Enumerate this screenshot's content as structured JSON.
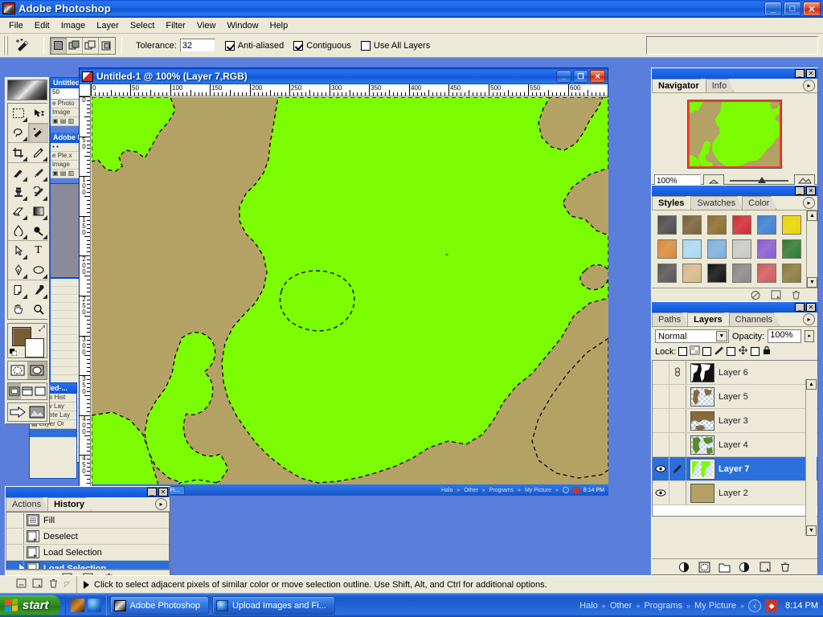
{
  "app": {
    "title": "Adobe Photoshop",
    "icon": "photoshop-icon",
    "window_buttons": {
      "minimize": "_",
      "maximize": "□",
      "close": "✕"
    }
  },
  "menu": [
    {
      "label": "File"
    },
    {
      "label": "Edit"
    },
    {
      "label": "Image"
    },
    {
      "label": "Layer"
    },
    {
      "label": "Select"
    },
    {
      "label": "Filter"
    },
    {
      "label": "View"
    },
    {
      "label": "Window"
    },
    {
      "label": "Help"
    }
  ],
  "options_bar": {
    "active_tool": "magic-wand-tool",
    "selection_modes": [
      "new-selection",
      "add-to-selection",
      "subtract-from-selection",
      "intersect-with-selection"
    ],
    "selection_mode_active": 0,
    "tolerance_label": "Tolerance:",
    "tolerance_value": "32",
    "anti_aliased_label": "Anti-aliased",
    "anti_aliased_checked": true,
    "contiguous_label": "Contiguous",
    "contiguous_checked": true,
    "use_all_layers_label": "Use All Layers",
    "use_all_layers_checked": false
  },
  "tools": [
    {
      "name": "marquee-tool",
      "glyph": "▭"
    },
    {
      "name": "move-tool",
      "glyph": "✥"
    },
    {
      "name": "lasso-tool",
      "glyph": "◠"
    },
    {
      "name": "magic-wand-tool",
      "glyph": "✸"
    },
    {
      "name": "crop-tool",
      "glyph": "⌗"
    },
    {
      "name": "slice-tool",
      "glyph": "✎"
    },
    {
      "name": "healing-brush-tool",
      "glyph": "✒"
    },
    {
      "name": "brush-tool",
      "glyph": "🖌"
    },
    {
      "name": "clone-stamp-tool",
      "glyph": "⎙"
    },
    {
      "name": "history-brush-tool",
      "glyph": "⟲"
    },
    {
      "name": "eraser-tool",
      "glyph": "▱"
    },
    {
      "name": "gradient-tool",
      "glyph": "▦"
    },
    {
      "name": "blur-tool",
      "glyph": "💧"
    },
    {
      "name": "dodge-tool",
      "glyph": "●"
    },
    {
      "name": "path-selection-tool",
      "glyph": "↖"
    },
    {
      "name": "type-tool",
      "glyph": "T"
    },
    {
      "name": "pen-tool",
      "glyph": "✑"
    },
    {
      "name": "shape-tool",
      "glyph": "⬭"
    },
    {
      "name": "notes-tool",
      "glyph": "▤"
    },
    {
      "name": "eyedropper-tool",
      "glyph": "⚲"
    },
    {
      "name": "hand-tool",
      "glyph": "✋"
    },
    {
      "name": "zoom-tool",
      "glyph": "🔍"
    }
  ],
  "color_swatches": {
    "foreground": "#7a5c34",
    "background": "#ffffff"
  },
  "document": {
    "title": "Untitled-1 @ 100% (Layer 7,RGB)",
    "zoom": "100%",
    "mode": "RGB",
    "active_layer": "Layer 7",
    "ruler_h_labels": [
      "0",
      "50",
      "100",
      "150",
      "200",
      "250",
      "300",
      "350",
      "400",
      "450",
      "500",
      "550",
      "600"
    ],
    "ruler_v_labels": [
      "0",
      "50",
      "100",
      "150",
      "200",
      "250",
      "300",
      "350",
      "400",
      "450"
    ],
    "canvas_colors": {
      "land": "#7cfc00",
      "water": "#b3a263"
    }
  },
  "navigator": {
    "tabs": [
      {
        "label": "Navigator",
        "active": true
      },
      {
        "label": "Info",
        "active": false
      }
    ],
    "zoom_value": "100%",
    "menu_icon": "panel-menu-icon"
  },
  "styles": {
    "tabs": [
      {
        "label": "Styles",
        "active": true
      },
      {
        "label": "Swatches",
        "active": false
      },
      {
        "label": "Color",
        "active": false
      }
    ],
    "swatches": [
      "#4a4a4a",
      "#7a6134",
      "#8a6c2e",
      "#d02a32",
      "#3a7fd0",
      "#e8d400",
      "#d98a3a",
      "#a8d8f0",
      "#7ab0e0",
      "#c8c8c8",
      "#8a5ad0",
      "#2e7a2e",
      "#555555",
      "#d8b888",
      "#111111",
      "#888888",
      "#d05a5a",
      "#8a7a3a"
    ],
    "footer_icons": [
      "clear-style-icon",
      "new-style-icon",
      "delete-style-icon"
    ]
  },
  "layers_panel": {
    "tabs": [
      {
        "label": "Paths",
        "active": false
      },
      {
        "label": "Layers",
        "active": true
      },
      {
        "label": "Channels",
        "active": false
      }
    ],
    "blend_mode": "Normal",
    "opacity_label": "Opacity:",
    "opacity_value": "100%",
    "lock_label": "Lock:",
    "lock_items": [
      "lock-transparent-icon",
      "lock-image-icon",
      "lock-position-icon",
      "lock-all-icon"
    ],
    "layers": [
      {
        "name": "Layer 6",
        "visible": false,
        "linked": true,
        "selected": false,
        "thumb": "black-white-map"
      },
      {
        "name": "Layer 5",
        "visible": false,
        "linked": false,
        "selected": false,
        "thumb": "brown-transparent-map"
      },
      {
        "name": "Layer 3",
        "visible": false,
        "linked": false,
        "selected": false,
        "thumb": "brown-map"
      },
      {
        "name": "Layer 4",
        "visible": false,
        "linked": false,
        "selected": false,
        "thumb": "green-map"
      },
      {
        "name": "Layer 7",
        "visible": true,
        "linked": false,
        "selected": true,
        "thumb": "green-shape"
      },
      {
        "name": "Layer 2",
        "visible": true,
        "linked": false,
        "selected": false,
        "thumb": "solid-tan"
      }
    ],
    "footer_icons": [
      "layer-style-icon",
      "layer-mask-icon",
      "new-group-icon",
      "adjustment-layer-icon",
      "new-layer-icon",
      "delete-layer-icon"
    ]
  },
  "history_panel": {
    "tabs": [
      {
        "label": "Actions",
        "active": false
      },
      {
        "label": "History",
        "active": true
      }
    ],
    "items": [
      {
        "label": "Fill",
        "selected": false
      },
      {
        "label": "Deselect",
        "selected": false
      },
      {
        "label": "Load Selection",
        "selected": false
      },
      {
        "label": "Load Selection",
        "selected": true
      }
    ],
    "footer_icons": [
      "new-document-icon",
      "new-snapshot-icon",
      "delete-state-icon"
    ]
  },
  "status_bar": {
    "hint": "Click to select adjacent pixels of similar color or move selection outline.  Use Shift, Alt, and Ctrl for additional options."
  },
  "taskbar": {
    "start_label": "start",
    "quick_launch": [
      "media-player-icon",
      "browser-icon"
    ],
    "tasks": [
      {
        "label": "Adobe Photoshop",
        "icon": "photoshop-icon",
        "active": true
      },
      {
        "label": "Upload Images and Fi...",
        "icon": "internet-explorer-icon",
        "active": false
      }
    ],
    "tray_labels": [
      "Halo",
      "Other",
      "Programs",
      "My Picture"
    ],
    "tray_icons": [
      "show-hidden-icon",
      "antivirus-icon"
    ],
    "clock": "8:14 PM"
  },
  "background_windows": [
    {
      "title": "Untitled-..."
    },
    {
      "title": "Adobe Photo..."
    },
    {
      "title": "Untitled-..."
    }
  ]
}
